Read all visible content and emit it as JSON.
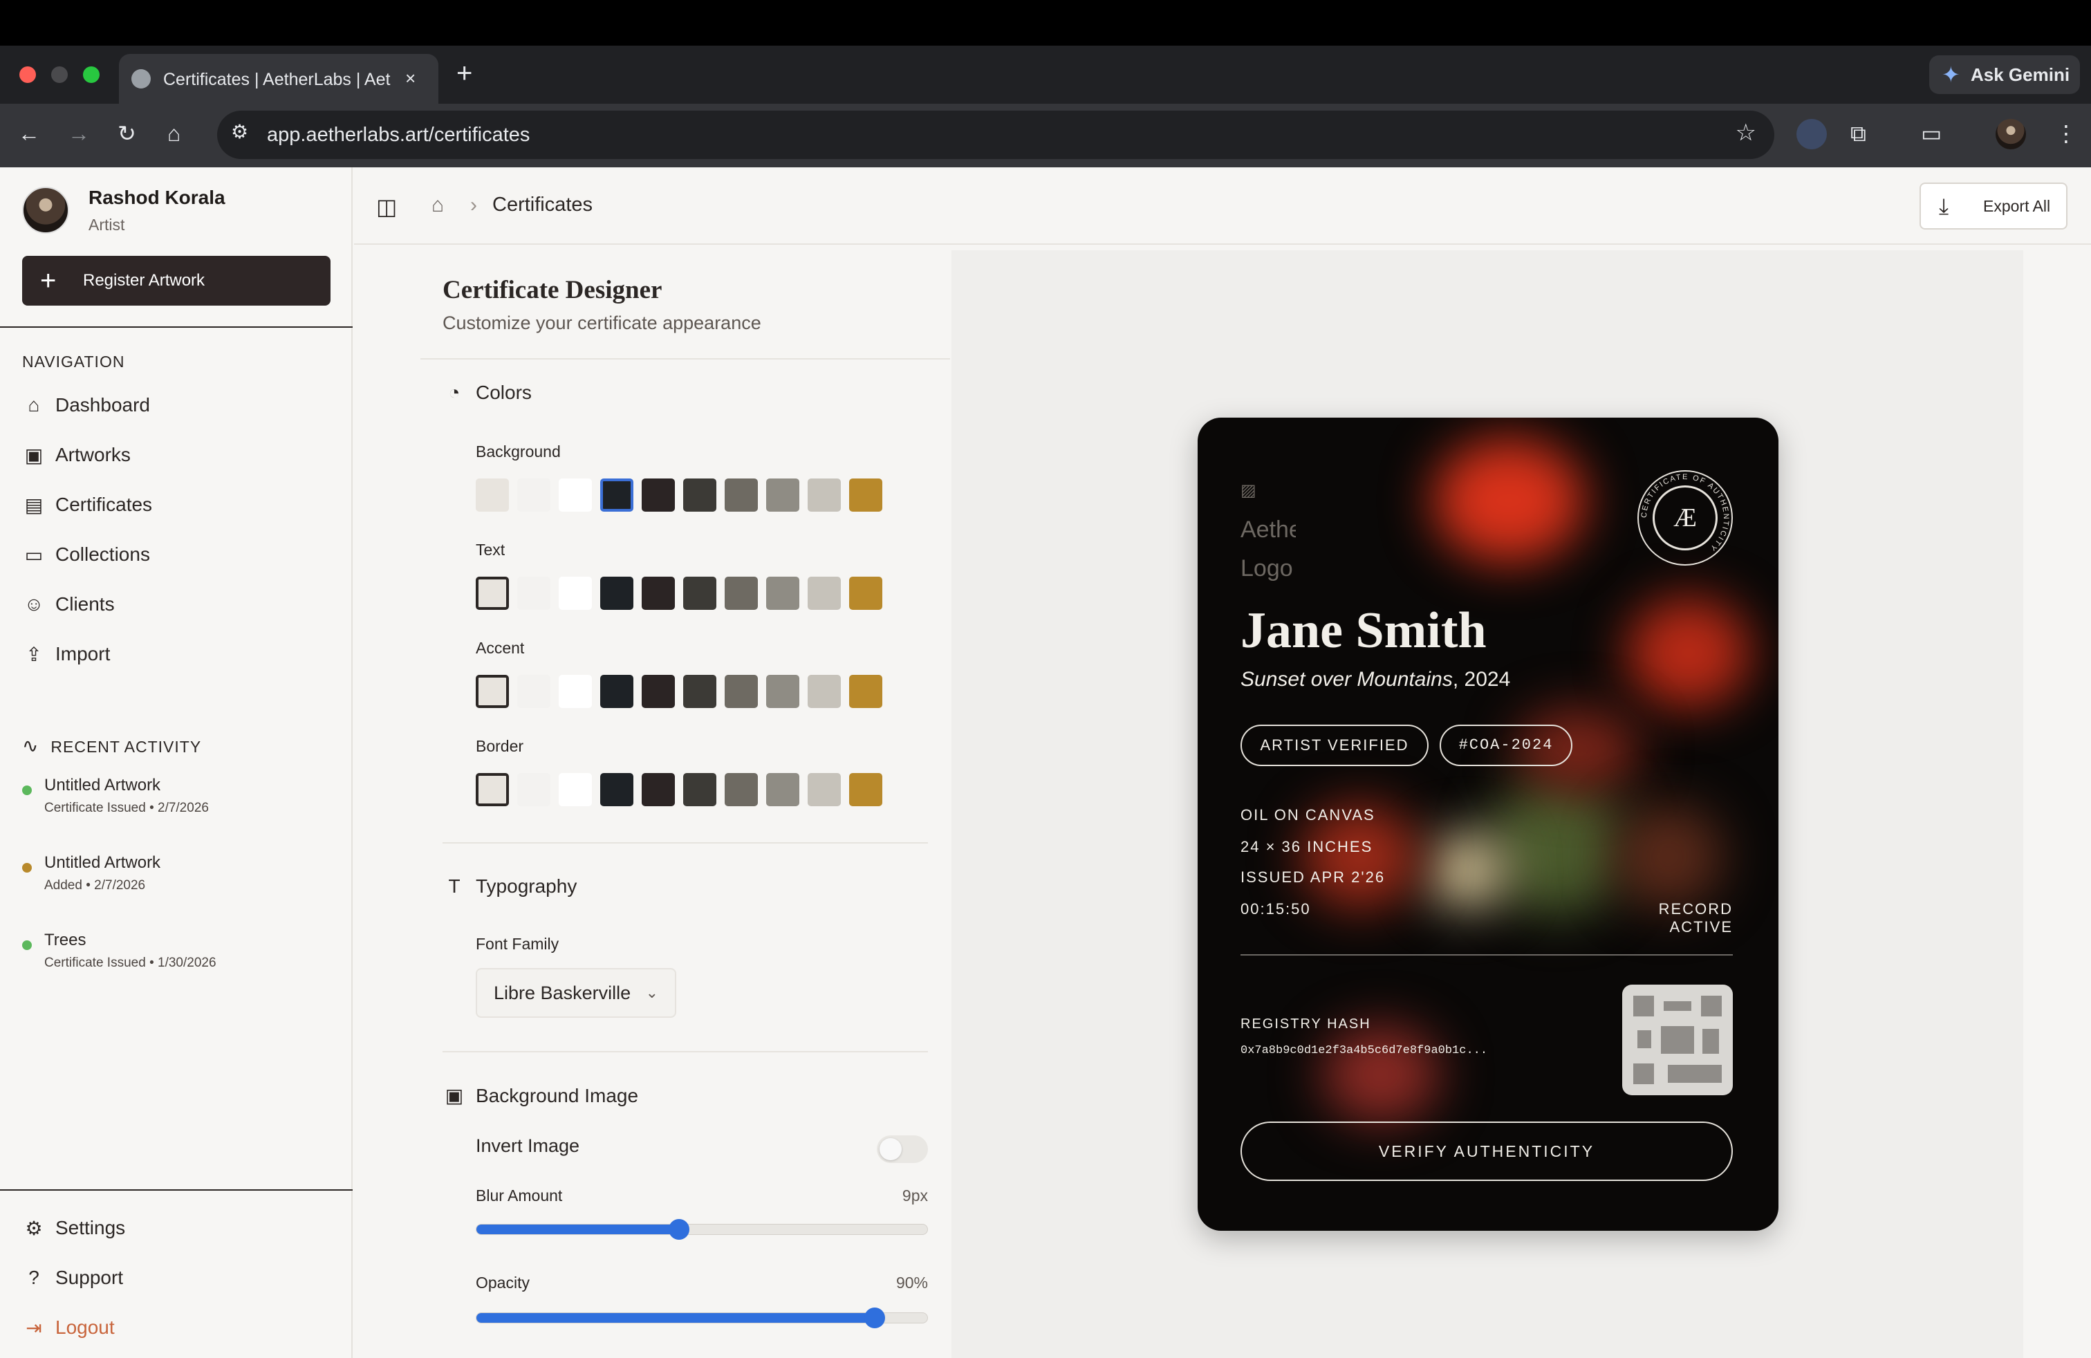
{
  "browser": {
    "tab_title": "Certificates | AetherLabs | AetherLabs",
    "tab_close": "×",
    "new_tab": "+",
    "ask_gemini": "Ask Gemini",
    "url": "app.aetherlabs.art/certificates"
  },
  "user": {
    "name": "Rashod Korala",
    "role": "Artist"
  },
  "sidebar": {
    "register_label": "Register Artwork",
    "nav_heading": "NAVIGATION",
    "nav": [
      {
        "label": "Dashboard",
        "icon": "home-icon"
      },
      {
        "label": "Artworks",
        "icon": "image-icon"
      },
      {
        "label": "Certificates",
        "icon": "certificate-icon"
      },
      {
        "label": "Collections",
        "icon": "folder-icon"
      },
      {
        "label": "Clients",
        "icon": "users-icon"
      },
      {
        "label": "Import",
        "icon": "import-icon"
      }
    ],
    "activity_heading": "RECENT ACTIVITY",
    "activity": [
      {
        "title": "Untitled Artwork",
        "sub": "Certificate Issued • 2/7/2026",
        "color": "#5cb85c"
      },
      {
        "title": "Untitled Artwork",
        "sub": "Added • 2/7/2026",
        "color": "#b8892b"
      },
      {
        "title": "Trees",
        "sub": "Certificate Issued • 1/30/2026",
        "color": "#5cb85c"
      }
    ],
    "settings": "Settings",
    "support": "Support",
    "logout": "Logout",
    "logout_color": "#c8643b"
  },
  "header": {
    "breadcrumb": "Certificates",
    "export_label": "Export All"
  },
  "designer": {
    "title": "Certificate Designer",
    "subtitle": "Customize your certificate appearance",
    "colors_heading": "Colors",
    "palette": [
      "#e8e4de",
      "#f3f2f0",
      "#ffffff",
      "#1e2226",
      "#2b2424",
      "#3c3a36",
      "#6e6a62",
      "#8f8c84",
      "#c6c2ba",
      "#b8892b"
    ],
    "rows": [
      {
        "label": "Background",
        "selected": 3
      },
      {
        "label": "Text",
        "selected": 0
      },
      {
        "label": "Accent",
        "selected": 0
      },
      {
        "label": "Border",
        "selected": 0
      }
    ],
    "typography_heading": "Typography",
    "font_family_label": "Font Family",
    "font_family_value": "Libre Baskerville",
    "bg_image_heading": "Background Image",
    "invert_label": "Invert Image",
    "invert_on": false,
    "blur_label": "Blur Amount",
    "blur_value": "9px",
    "blur_fraction": 0.45,
    "opacity_label": "Opacity",
    "opacity_value": "90%",
    "opacity_fraction": 0.883
  },
  "certificate": {
    "logo_alt": "AetherLabs Logo",
    "seal_text": "CERTIFICATE OF AUTHENTICITY",
    "seal_mark": "Æ",
    "artist": "Jane Smith",
    "artwork": "Sunset over Mountains",
    "year": ", 2024",
    "badge_verified": "ARTIST VERIFIED",
    "badge_id": "#COA-2024",
    "medium": "OIL ON CANVAS",
    "dimensions": "24 × 36 INCHES",
    "issued": "ISSUED APR 2'26",
    "timer": "00:15:50",
    "record_status": "RECORD ACTIVE",
    "registry_label": "REGISTRY HASH",
    "registry_hash": "0x7a8b9c0d1e2f3a4b5c6d7e8f9a0b1c...",
    "verify_label": "VERIFY AUTHENTICITY"
  }
}
